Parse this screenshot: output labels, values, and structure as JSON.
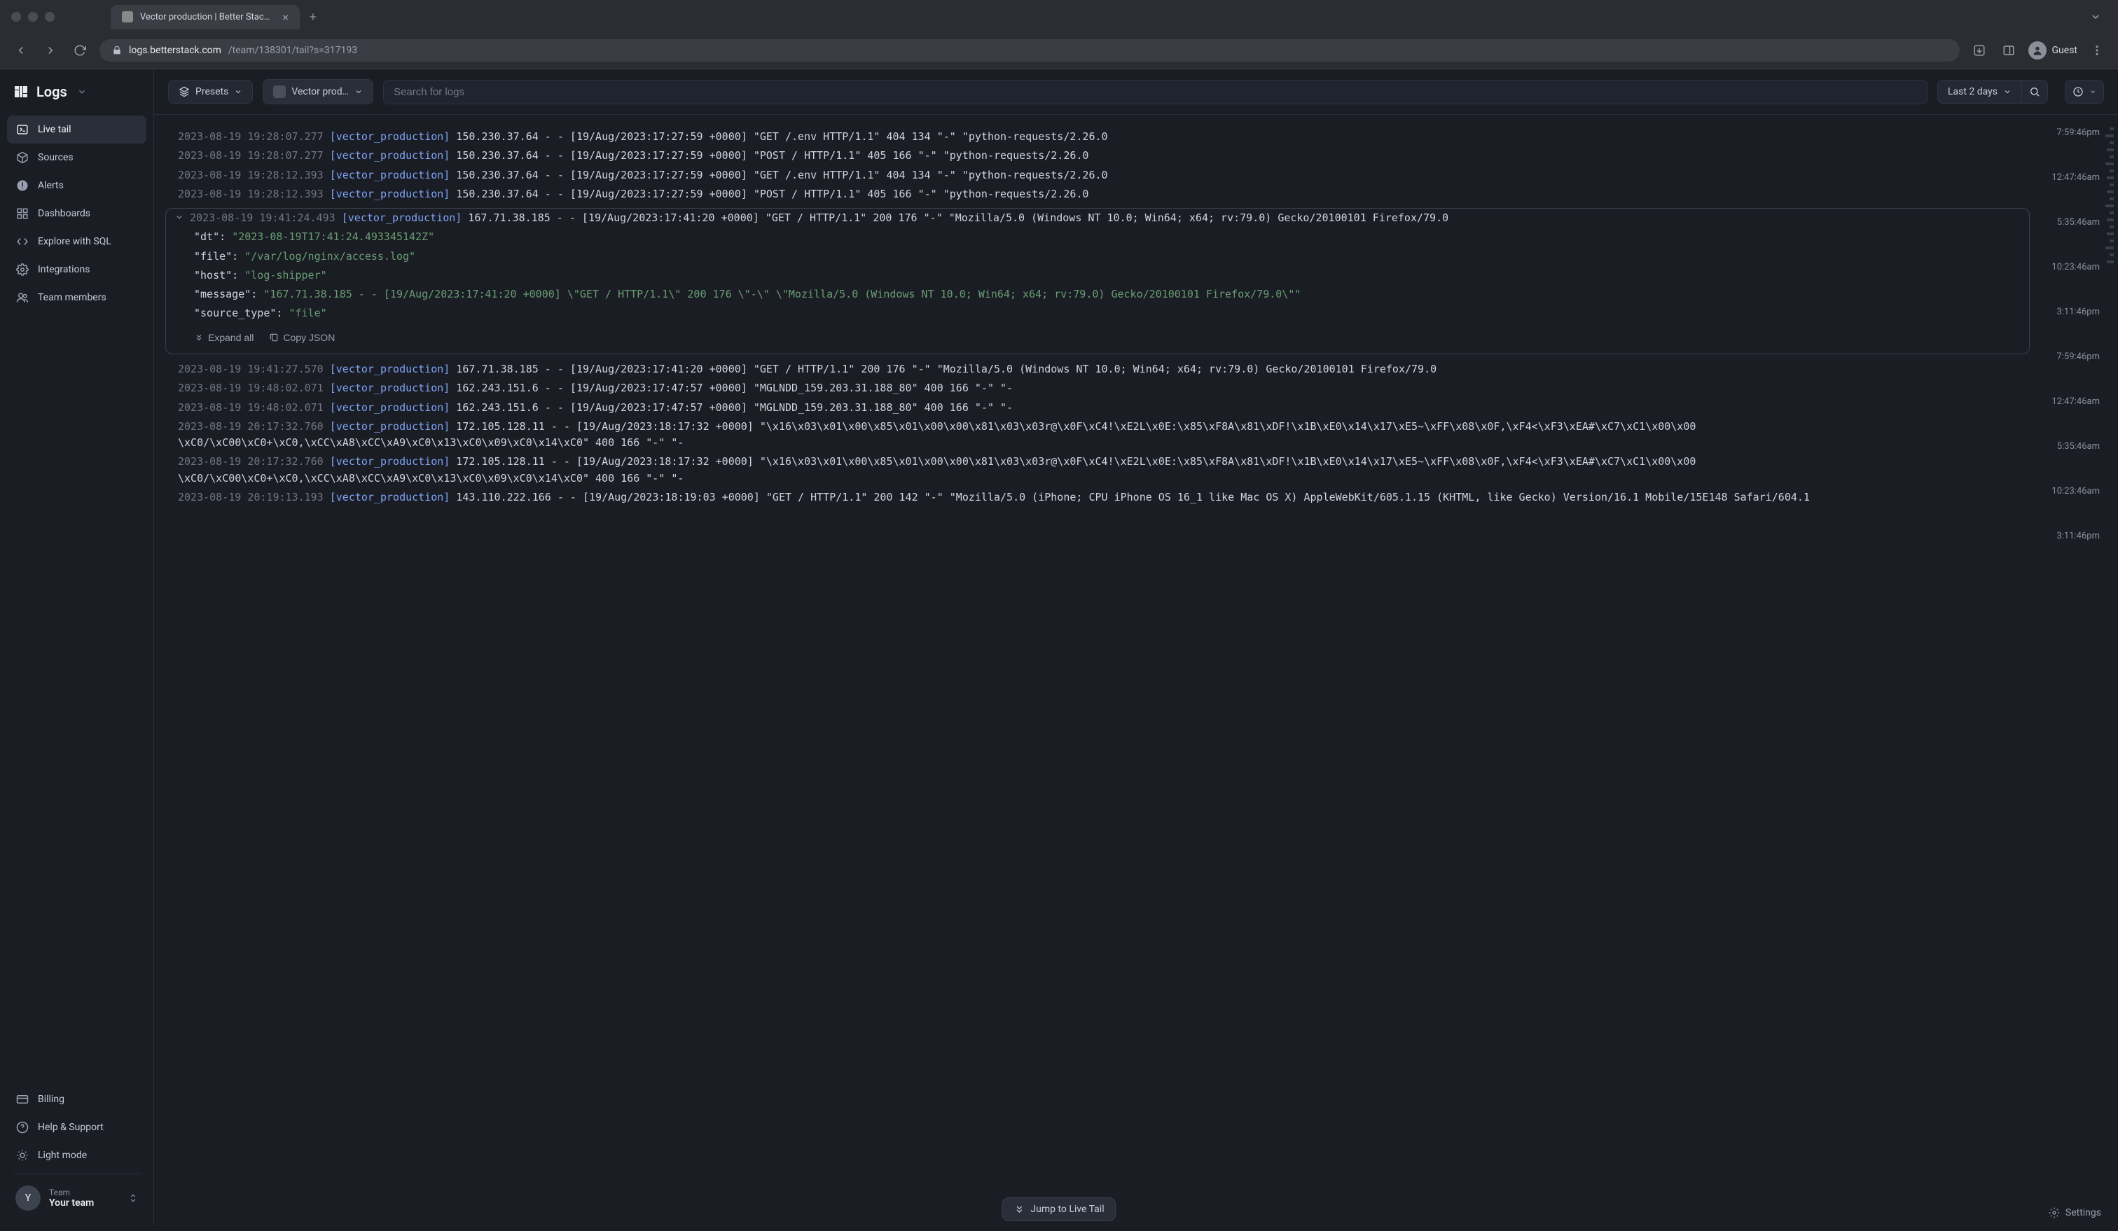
{
  "browser": {
    "tab_title": "Vector production | Better Stac…",
    "url_domain": "logs.betterstack.com",
    "url_path": "/team/138301/tail?s=317193",
    "guest_label": "Guest"
  },
  "logo": {
    "text": "Logs"
  },
  "sidebar": {
    "items": [
      {
        "label": "Live tail",
        "icon": "terminal-icon"
      },
      {
        "label": "Sources",
        "icon": "box-icon"
      },
      {
        "label": "Alerts",
        "icon": "alert-icon"
      },
      {
        "label": "Dashboards",
        "icon": "grid-icon"
      },
      {
        "label": "Explore with SQL",
        "icon": "code-icon"
      },
      {
        "label": "Integrations",
        "icon": "gear-icon"
      },
      {
        "label": "Team members",
        "icon": "users-icon"
      }
    ],
    "bottom": [
      {
        "label": "Billing",
        "icon": "card-icon"
      },
      {
        "label": "Help & Support",
        "icon": "help-icon"
      },
      {
        "label": "Light mode",
        "icon": "sun-icon"
      }
    ],
    "team": {
      "label": "Team",
      "name": "Your team",
      "initial": "Y"
    }
  },
  "toolbar": {
    "presets_label": "Presets",
    "source_label": "Vector prod…",
    "search_placeholder": "Search for logs",
    "range_label": "Last 2 days"
  },
  "logs": [
    {
      "ts": "2023-08-19 19:28:07.277",
      "src": "[vector_production]",
      "msg": "150.230.37.64 - - [19/Aug/2023:17:27:59 +0000] \"GET /.env HTTP/1.1\" 404 134 \"-\" \"python-requests/2.26.0"
    },
    {
      "ts": "2023-08-19 19:28:07.277",
      "src": "[vector_production]",
      "msg": "150.230.37.64 - - [19/Aug/2023:17:27:59 +0000] \"POST / HTTP/1.1\" 405 166 \"-\" \"python-requests/2.26.0"
    },
    {
      "ts": "2023-08-19 19:28:12.393",
      "src": "[vector_production]",
      "msg": "150.230.37.64 - - [19/Aug/2023:17:27:59 +0000] \"GET /.env HTTP/1.1\" 404 134 \"-\" \"python-requests/2.26.0"
    },
    {
      "ts": "2023-08-19 19:28:12.393",
      "src": "[vector_production]",
      "msg": "150.230.37.64 - - [19/Aug/2023:17:27:59 +0000] \"POST / HTTP/1.1\" 405 166 \"-\" \"python-requests/2.26.0"
    }
  ],
  "expanded": {
    "header": {
      "ts": "2023-08-19 19:41:24.493",
      "src": "[vector_production]",
      "msg": "167.71.38.185 - - [19/Aug/2023:17:41:20 +0000] \"GET / HTTP/1.1\" 200 176 \"-\" \"Mozilla/5.0 (Windows NT 10.0; Win64; x64; rv:79.0) Gecko/20100101 Firefox/79.0"
    },
    "fields": [
      {
        "k": "\"dt\":",
        "v": "\"2023-08-19T17:41:24.493345142Z\""
      },
      {
        "k": "\"file\":",
        "v": "\"/var/log/nginx/access.log\""
      },
      {
        "k": "\"host\":",
        "v": "\"log-shipper\""
      },
      {
        "k": "\"message\":",
        "v": "\"167.71.38.185 - - [19/Aug/2023:17:41:20 +0000] \\\"GET / HTTP/1.1\\\" 200 176 \\\"-\\\" \\\"Mozilla/5.0 (Windows NT 10.0; Win64; x64; rv:79.0) Gecko/20100101 Firefox/79.0\\\"\""
      },
      {
        "k": "\"source_type\":",
        "v": "\"file\""
      }
    ],
    "expand_all": "Expand all",
    "copy_json": "Copy JSON"
  },
  "logs_after": [
    {
      "ts": "2023-08-19 19:41:27.570",
      "src": "[vector_production]",
      "msg": "167.71.38.185 - - [19/Aug/2023:17:41:20 +0000] \"GET / HTTP/1.1\" 200 176 \"-\" \"Mozilla/5.0 (Windows NT 10.0; Win64; x64; rv:79.0) Gecko/20100101 Firefox/79.0"
    },
    {
      "ts": "2023-08-19 19:48:02.071",
      "src": "[vector_production]",
      "msg": "162.243.151.6 - - [19/Aug/2023:17:47:57 +0000] \"MGLNDD_159.203.31.188_80\" 400 166 \"-\" \"-"
    },
    {
      "ts": "2023-08-19 19:48:02.071",
      "src": "[vector_production]",
      "msg": "162.243.151.6 - - [19/Aug/2023:17:47:57 +0000] \"MGLNDD_159.203.31.188_80\" 400 166 \"-\" \"-"
    },
    {
      "ts": "2023-08-19 20:17:32.760",
      "src": "[vector_production]",
      "msg": "172.105.128.11 - - [19/Aug/2023:18:17:32 +0000] \"\\x16\\x03\\x01\\x00\\x85\\x01\\x00\\x00\\x81\\x03\\x03r@\\x0F\\xC4!\\xE2L\\x0E:\\x85\\xF8A\\x81\\xDF!\\x1B\\xE0\\x14\\x17\\xE5~\\xFF\\x08\\x0F,\\xF4<\\xF3\\xEA#\\xC7\\xC1\\x00\\x00 \\xC0/\\xC00\\xC0+\\xC0,\\xCC\\xA8\\xCC\\xA9\\xC0\\x13\\xC0\\x09\\xC0\\x14\\xC0\" 400 166 \"-\" \"-"
    },
    {
      "ts": "2023-08-19 20:17:32.760",
      "src": "[vector_production]",
      "msg": "172.105.128.11 - - [19/Aug/2023:18:17:32 +0000] \"\\x16\\x03\\x01\\x00\\x85\\x01\\x00\\x00\\x81\\x03\\x03r@\\x0F\\xC4!\\xE2L\\x0E:\\x85\\xF8A\\x81\\xDF!\\x1B\\xE0\\x14\\x17\\xE5~\\xFF\\x08\\x0F,\\xF4<\\xF3\\xEA#\\xC7\\xC1\\x00\\x00 \\xC0/\\xC00\\xC0+\\xC0,\\xCC\\xA8\\xCC\\xA9\\xC0\\x13\\xC0\\x09\\xC0\\x14\\xC0\" 400 166 \"-\" \"-"
    },
    {
      "ts": "2023-08-19 20:19:13.193",
      "src": "[vector_production]",
      "msg": "143.110.222.166 - - [19/Aug/2023:18:19:03 +0000] \"GET / HTTP/1.1\" 200 142 \"-\" \"Mozilla/5.0 (iPhone; CPU iPhone OS 16_1 like Mac OS X) AppleWebKit/605.1.15 (KHTML, like Gecko) Version/16.1 Mobile/15E148 Safari/604.1"
    }
  ],
  "timeline": {
    "labels": [
      "7:59:46pm",
      "12:47:46am",
      "5:35:46am",
      "10:23:46am",
      "3:11:46pm",
      "7:59:46pm",
      "12:47:46am",
      "5:35:46am",
      "10:23:46am",
      "3:11:46pm"
    ]
  },
  "footer": {
    "jump": "Jump to Live Tail",
    "settings": "Settings"
  }
}
